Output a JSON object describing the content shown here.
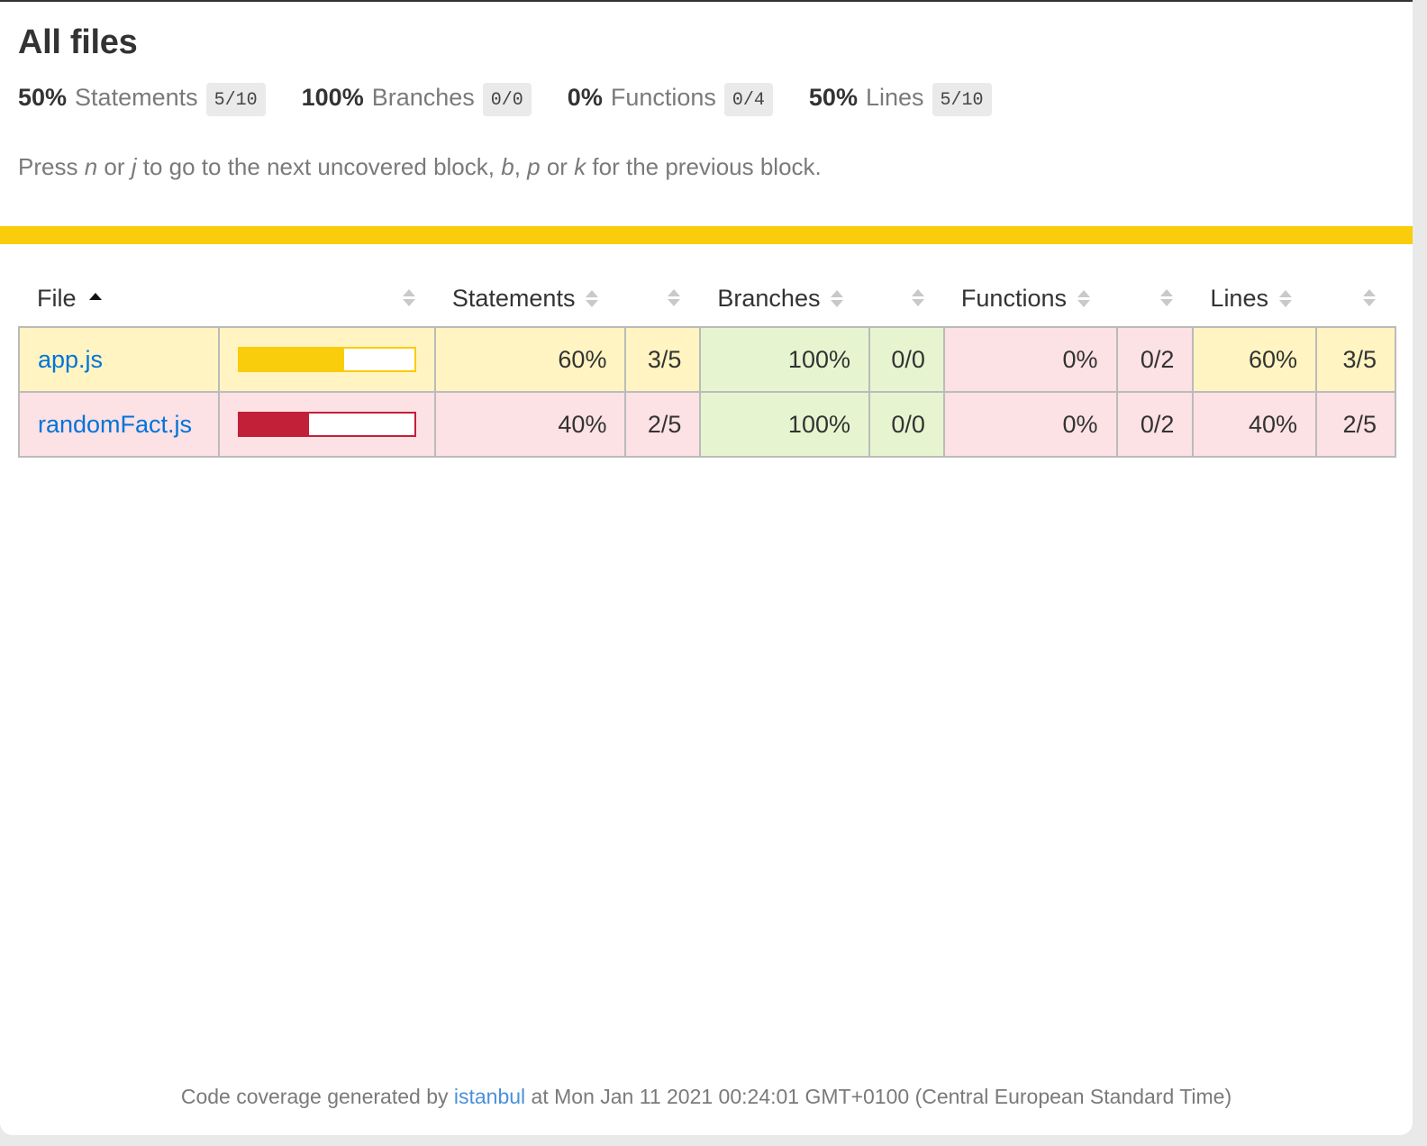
{
  "header": {
    "title": "All files"
  },
  "summary": [
    {
      "pct": "50%",
      "label": "Statements",
      "fraction": "5/10"
    },
    {
      "pct": "100%",
      "label": "Branches",
      "fraction": "0/0"
    },
    {
      "pct": "0%",
      "label": "Functions",
      "fraction": "0/4"
    },
    {
      "pct": "50%",
      "label": "Lines",
      "fraction": "5/10"
    }
  ],
  "hint": {
    "press": "Press ",
    "key_n": "n",
    "or1": " or ",
    "key_j": "j",
    "mid": " to go to the next uncovered block, ",
    "key_b": "b",
    "comma": ", ",
    "key_p": "p",
    "or2": " or ",
    "key_k": "k",
    "end": " for the previous block."
  },
  "status_color": "#f9cd0b",
  "table": {
    "headers": {
      "file": "File",
      "statements": "Statements",
      "branches": "Branches",
      "functions": "Functions",
      "lines": "Lines"
    },
    "rows": [
      {
        "file": "app.js",
        "coverage": 0.6,
        "level": "medium",
        "statements_pct": "60%",
        "statements_frac": "3/5",
        "branches_pct": "100%",
        "branches_frac": "0/0",
        "functions_pct": "0%",
        "functions_frac": "0/2",
        "lines_pct": "60%",
        "lines_frac": "3/5"
      },
      {
        "file": "randomFact.js",
        "coverage": 0.4,
        "level": "low",
        "statements_pct": "40%",
        "statements_frac": "2/5",
        "branches_pct": "100%",
        "branches_frac": "0/0",
        "functions_pct": "0%",
        "functions_frac": "0/2",
        "lines_pct": "40%",
        "lines_frac": "2/5"
      }
    ]
  },
  "footer": {
    "prefix": "Code coverage generated by ",
    "link": "istanbul",
    "suffix": " at Mon Jan 11 2021 00:24:01 GMT+0100 (Central European Standard Time)"
  },
  "colors": {
    "medium": "#fff4c2",
    "high": "#e6f5d0",
    "low": "#fce1e5",
    "bar_medium": "#f9cd0b",
    "bar_low": "#c21f39",
    "link": "#0074d9"
  }
}
